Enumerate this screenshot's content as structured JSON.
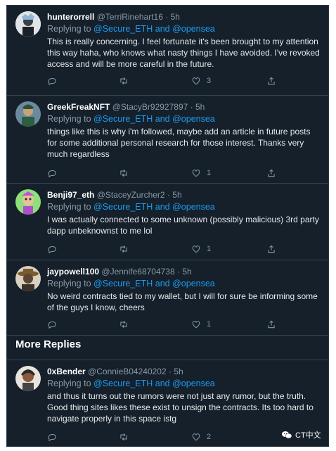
{
  "replying_label": "Replying to",
  "and_label": "and",
  "section_more": "More Replies",
  "watermark": "CT中文",
  "tweets": [
    {
      "name": "hunterorrell",
      "handle": "@TerriRinehart16",
      "time": "5h",
      "mention1": "@Secure_ETH",
      "mention2": "@opensea",
      "text": "This is really concerning. I feel fortunate it's been brought to my attention this way haha, who knows what nasty things I have avoided. I've revoked access and will be more careful in the future.",
      "likes": "3"
    },
    {
      "name": "GreekFreakNFT",
      "handle": "@StacyBr92927897",
      "time": "5h",
      "mention1": "@Secure_ETH",
      "mention2": "@opensea",
      "text": "things like this is why i'm followed, maybe add an article in future posts for some additional personal research for those interest. Thanks very much regardless",
      "likes": "1"
    },
    {
      "name": "Benji97_eth",
      "handle": "@StaceyZurcher2",
      "time": "5h",
      "mention1": "@Secure_ETH",
      "mention2": "@opensea",
      "text": "I was actually connected to some unknown (possibly malicious) 3rd party dapp unbeknownst to me lol",
      "likes": "1"
    },
    {
      "name": "jaypowell100",
      "handle": "@Jennife68704738",
      "time": "5h",
      "mention1": "@Secure_ETH",
      "mention2": "@opensea",
      "text": "No weird contracts tied to my wallet, but I will for sure be informing some of the guys I know, cheers",
      "likes": "1"
    },
    {
      "name": "0xBender",
      "handle": "@ConnieB04240202",
      "time": "5h",
      "mention1": "@Secure_ETH",
      "mention2": "@opensea",
      "text": "and thus it turns out the rumors were not just any rumor, but the truth. Good thing sites likes these exist to unsign the contracts. Its too hard to navigate properly in this space istg",
      "likes": "2"
    }
  ],
  "colors": {
    "background": "#15202b",
    "text": "#e7e9ea",
    "muted": "#8899a6",
    "link": "#1d9bf0",
    "divider": "#38444d"
  },
  "icons": [
    "reply-icon",
    "retweet-icon",
    "like-icon",
    "share-icon",
    "wechat-icon"
  ]
}
